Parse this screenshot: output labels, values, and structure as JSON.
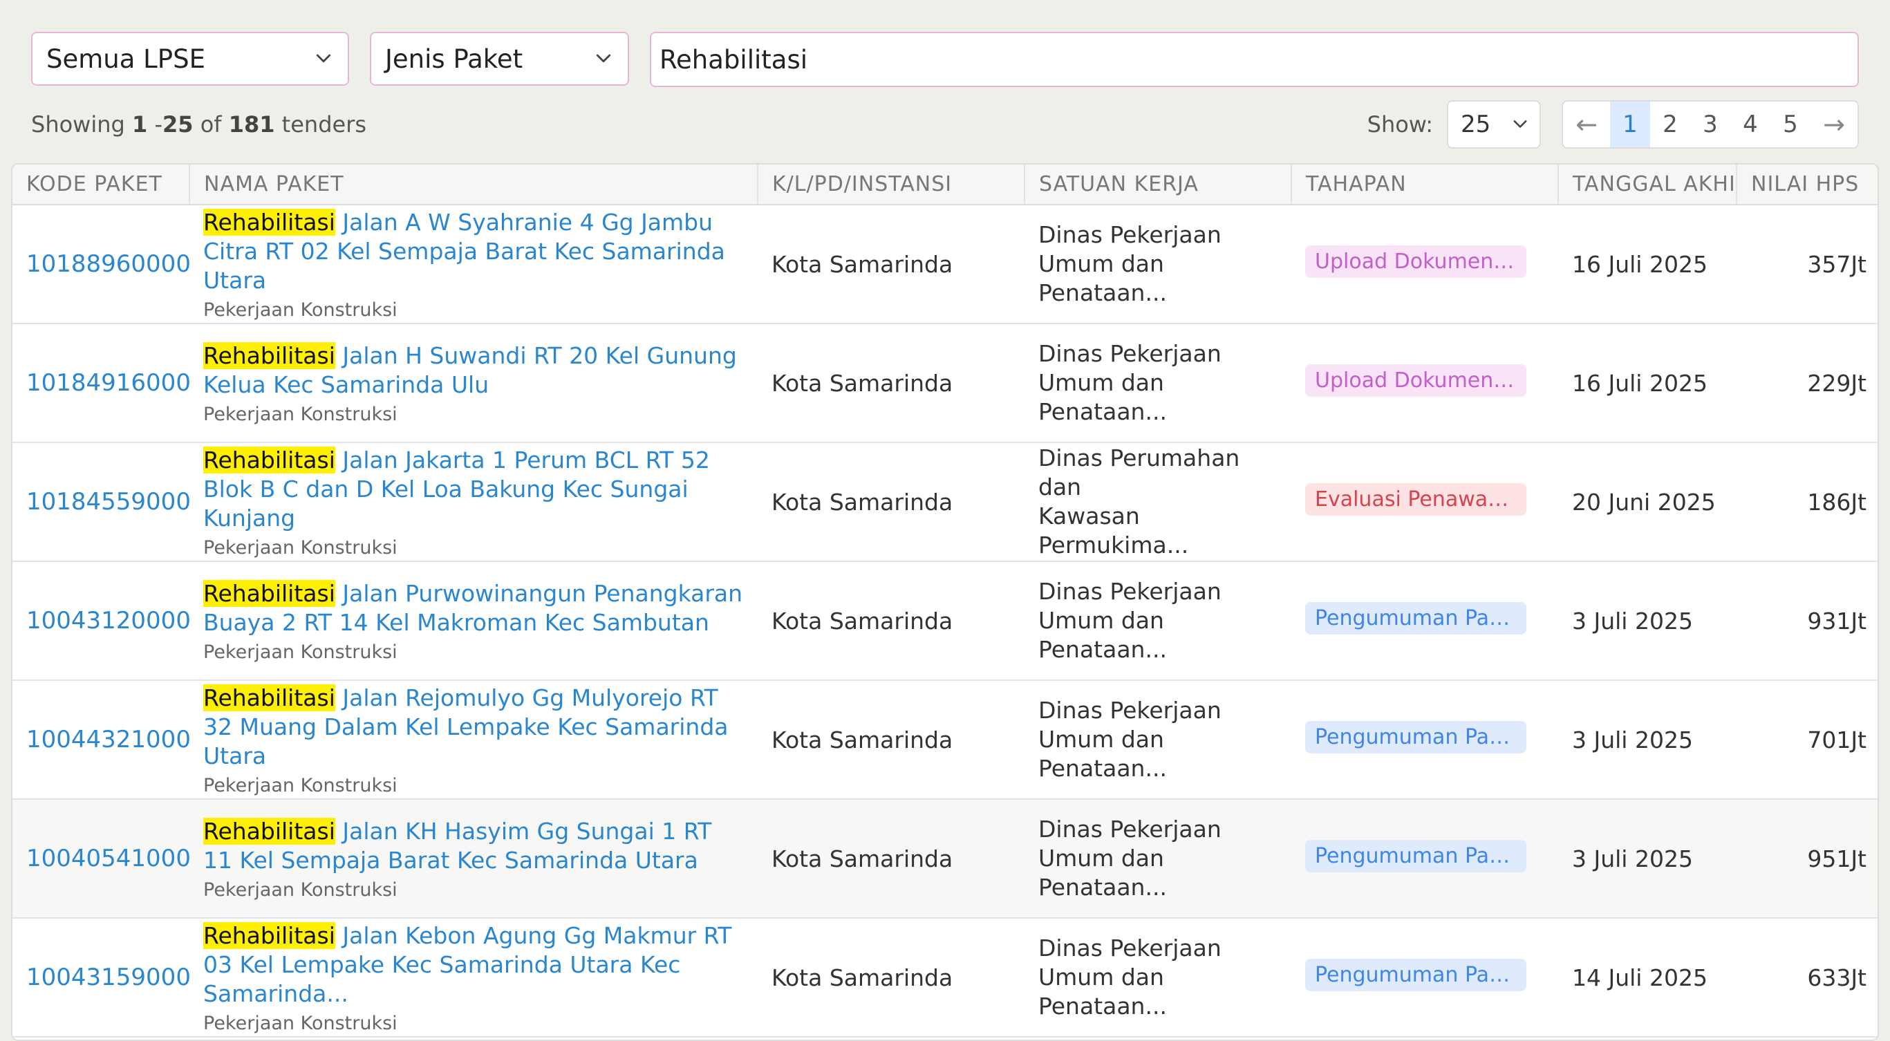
{
  "filters": {
    "lpse": "Semua LPSE",
    "jenis": "Jenis Paket",
    "search_value": "Rehabilitasi"
  },
  "summary": {
    "prefix": "Showing",
    "range_start": "1",
    "range_sep": " -",
    "range_end": "25",
    "of": " of ",
    "total": "181",
    "suffix": " tenders"
  },
  "show": {
    "label": "Show:",
    "value": "25"
  },
  "pagination": {
    "prev": "←",
    "next": "→",
    "pages": [
      "1",
      "2",
      "3",
      "4",
      "5"
    ],
    "active": "1"
  },
  "table": {
    "headers": [
      "KODE PAKET",
      "NAMA PAKET",
      "K/L/PD/INSTANSI",
      "SATUAN KERJA",
      "TAHAPAN",
      "TANGGAL AKHIR",
      "NILAI HPS"
    ],
    "highlight": "Rehabilitasi",
    "rows": [
      {
        "kode": "10188960000",
        "nama_rest": " Jalan A W Syahranie 4 Gg Jambu Citra RT 02 Kel Sempaja Barat Kec Samarinda Utara",
        "kategori": "Pekerjaan Konstruksi",
        "instansi": "Kota Samarinda",
        "satker": "Dinas Pekerjaan\nUmum dan Penataan...",
        "tahapan": "Upload Dokumen P...",
        "tahapan_type": "upload",
        "tanggal": "16 Juli 2025",
        "nilai": "357Jt"
      },
      {
        "kode": "10184916000",
        "nama_rest": " Jalan H Suwandi RT 20 Kel Gunung Kelua Kec Samarinda Ulu",
        "kategori": "Pekerjaan Konstruksi",
        "instansi": "Kota Samarinda",
        "satker": "Dinas Pekerjaan\nUmum dan Penataan...",
        "tahapan": "Upload Dokumen P...",
        "tahapan_type": "upload",
        "tanggal": "16 Juli 2025",
        "nilai": "229Jt"
      },
      {
        "kode": "10184559000",
        "nama_rest": " Jalan Jakarta 1 Perum BCL RT 52 Blok B C dan D Kel Loa Bakung Kec Sungai Kunjang",
        "kategori": "Pekerjaan Konstruksi",
        "instansi": "Kota Samarinda",
        "satker": "Dinas Perumahan dan\nKawasan Permukima...",
        "tahapan": "Evaluasi Penawaran",
        "tahapan_type": "eval",
        "tanggal": "20 Juni 2025",
        "nilai": "186Jt"
      },
      {
        "kode": "10043120000",
        "nama_rest": " Jalan Purwowinangun Penangkaran Buaya 2 RT 14 Kel Makroman Kec Sambutan",
        "kategori": "Pekerjaan Konstruksi",
        "instansi": "Kota Samarinda",
        "satker": "Dinas Pekerjaan\nUmum dan Penataan...",
        "tahapan": "Pengumuman Pasc...",
        "tahapan_type": "umum",
        "tanggal": "3 Juli 2025",
        "nilai": "931Jt"
      },
      {
        "kode": "10044321000",
        "nama_rest": " Jalan Rejomulyo Gg Mulyorejo RT 32 Muang Dalam Kel Lempake Kec Samarinda Utara",
        "kategori": "Pekerjaan Konstruksi",
        "instansi": "Kota Samarinda",
        "satker": "Dinas Pekerjaan\nUmum dan Penataan...",
        "tahapan": "Pengumuman Pasc...",
        "tahapan_type": "umum",
        "tanggal": "3 Juli 2025",
        "nilai": "701Jt"
      },
      {
        "kode": "10040541000",
        "nama_rest": " Jalan KH Hasyim Gg Sungai 1 RT 11 Kel Sempaja Barat Kec Samarinda Utara",
        "kategori": "Pekerjaan Konstruksi",
        "instansi": "Kota Samarinda",
        "satker": "Dinas Pekerjaan\nUmum dan Penataan...",
        "tahapan": "Pengumuman Pasc...",
        "tahapan_type": "umum",
        "tanggal": "3 Juli 2025",
        "nilai": "951Jt"
      },
      {
        "kode": "10043159000",
        "nama_rest": " Jalan Kebon Agung Gg Makmur RT 03 Kel Lempake Kec Samarinda Utara Kec Samarinda...",
        "kategori": "Pekerjaan Konstruksi",
        "instansi": "Kota Samarinda",
        "satker": "Dinas Pekerjaan\nUmum dan Penataan...",
        "tahapan": "Pengumuman Pasc...",
        "tahapan_type": "umum",
        "tanggal": "14 Juli 2025",
        "nilai": "633Jt"
      }
    ]
  }
}
